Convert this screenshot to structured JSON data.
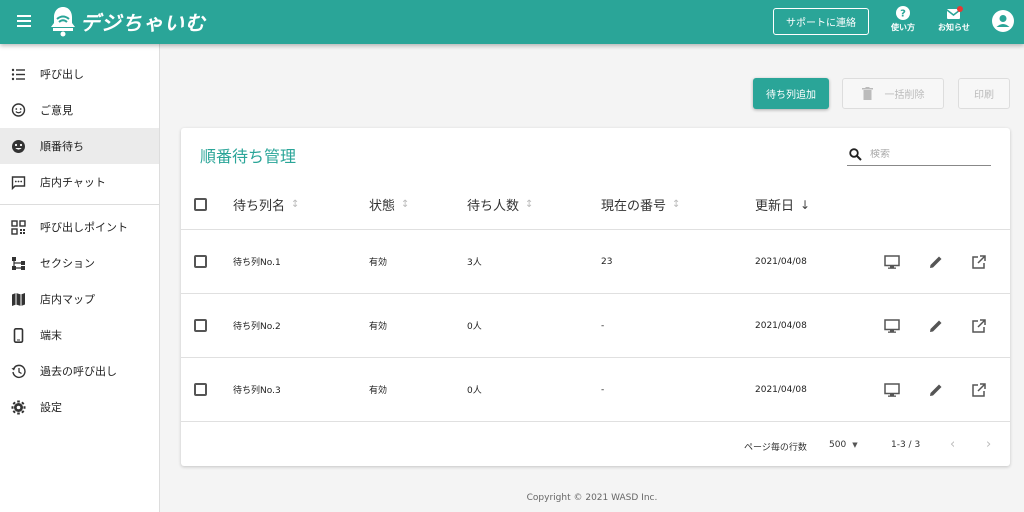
{
  "header": {
    "menu_icon": "hamburger-menu-icon",
    "logo_icon": "bell-icon",
    "logo_text": "デジちゃいむ",
    "contact_button": "サポートに連絡",
    "help_label": "使い方",
    "notice_label": "お知らせ",
    "accent_color": "#2aa598"
  },
  "sidebar": {
    "items": [
      {
        "label": "呼び出し",
        "icon": "list-icon"
      },
      {
        "label": "ご意見",
        "icon": "feedback-icon"
      },
      {
        "label": "順番待ち",
        "icon": "emoji-icon",
        "active": true
      },
      {
        "label": "店内チャット",
        "icon": "chat-icon"
      },
      {
        "label": "呼び出しポイント",
        "icon": "qr-icon"
      },
      {
        "label": "セクション",
        "icon": "sitemap-icon"
      },
      {
        "label": "店内マップ",
        "icon": "map-icon"
      },
      {
        "label": "端末",
        "icon": "smartphone-icon"
      },
      {
        "label": "過去の呼び出し",
        "icon": "history-icon"
      },
      {
        "label": "設定",
        "icon": "gear-icon"
      }
    ]
  },
  "actions": {
    "add_queue": "待ち列追加",
    "bulk_delete": "一括削除",
    "print": "印刷"
  },
  "card": {
    "title": "順番待ち管理",
    "search_placeholder": "検索"
  },
  "table": {
    "columns": [
      "待ち列名",
      "状態",
      "待ち人数",
      "現在の番号",
      "更新日"
    ],
    "sorted_column": "更新日",
    "rows": [
      {
        "name": "待ち列No.1",
        "status": "有効",
        "waiting": "3人",
        "current": "23",
        "updated": "2021/04/08"
      },
      {
        "name": "待ち列No.2",
        "status": "有効",
        "waiting": "0人",
        "current": "-",
        "updated": "2021/04/08"
      },
      {
        "name": "待ち列No.3",
        "status": "有効",
        "waiting": "0人",
        "current": "-",
        "updated": "2021/04/08"
      }
    ]
  },
  "pagination": {
    "rows_per_page_label": "ページ毎の行数",
    "rows_per_page": "500",
    "range": "1-3 / 3"
  },
  "footer": {
    "copyright": "Copyright © 2021 WASD Inc."
  }
}
